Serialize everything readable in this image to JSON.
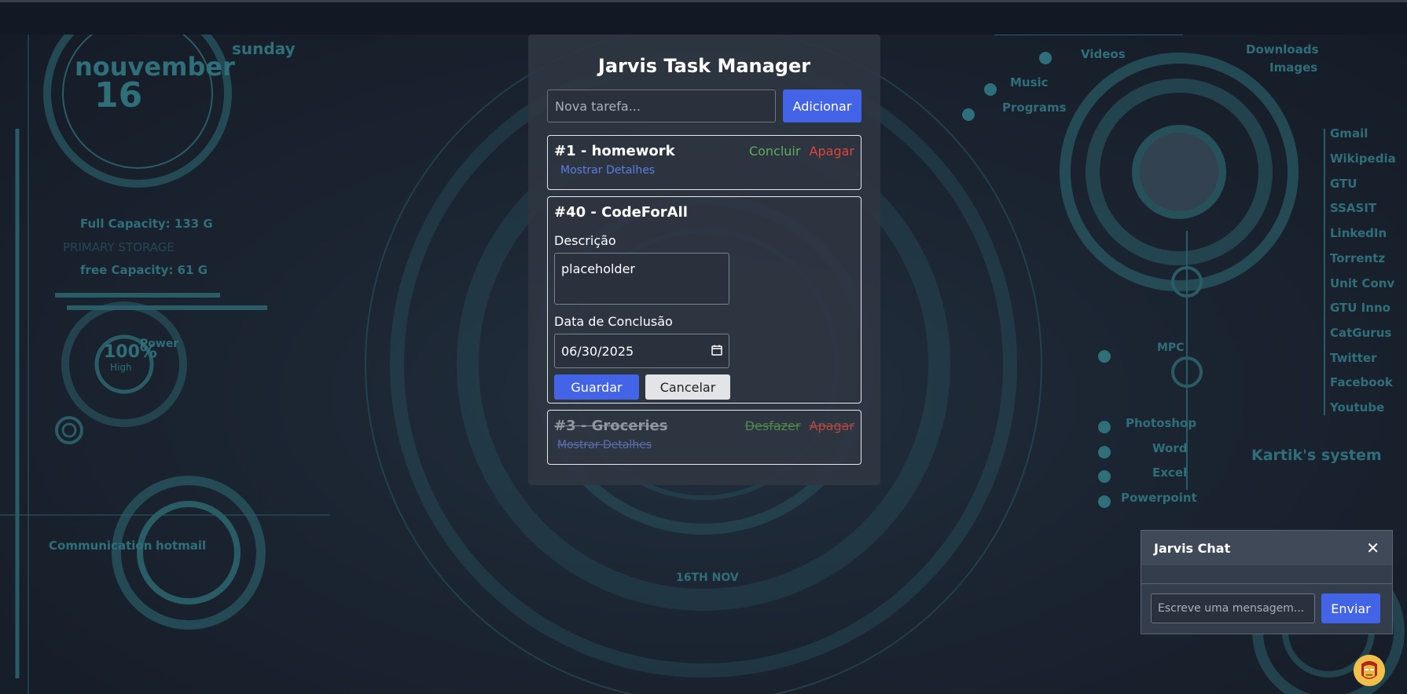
{
  "app": {
    "title": "Jarvis Task Manager"
  },
  "add_task": {
    "placeholder": "Nova tarefa...",
    "button_label": "Adicionar"
  },
  "tasks": [
    {
      "heading": "#1 - homework",
      "complete_label": "Concluir",
      "delete_label": "Apagar",
      "details_label": "Mostrar Detalhes",
      "completed": false
    },
    {
      "heading": "#40 - CodeForAll",
      "editing": true,
      "description_label": "Descrição",
      "description_value": "placeholder",
      "date_label": "Data de Conclusão",
      "date_value": "06/30/2025",
      "save_label": "Guardar",
      "cancel_label": "Cancelar"
    },
    {
      "heading": "#3 - Groceries",
      "undo_label": "Desfazer",
      "delete_label": "Apagar",
      "details_label": "Mostrar Detalhes",
      "completed": true
    }
  ],
  "chat": {
    "title": "Jarvis Chat",
    "close_symbol": "✕",
    "input_placeholder": "Escreve uma mensagem...",
    "send_label": "Enviar"
  },
  "background": {
    "month": "nouvember",
    "day_number": "16",
    "weekday": "sunday",
    "full_capacity": "Full Capacity:  133  G",
    "primary_storage": "PRIMARY STORAGE",
    "free_capacity": "free Capacity:  61  G",
    "power_pct": "100%",
    "power_label": "Power",
    "power_sub": "High",
    "communication": "Communication",
    "hotmail": "hotmail",
    "system_name": "Kartik's system",
    "hud_date": "16TH NOV",
    "links_top": [
      "Videos",
      "Downloads",
      "Images",
      "Music",
      "Programs"
    ],
    "links_right": [
      "Gmail",
      "Wikipedia",
      "GTU",
      "SSASIT",
      "LinkedIn",
      "Torrentz",
      "Unit Conv",
      "GTU Inno",
      "CatGurus",
      "Twitter",
      "Facebook",
      "Youtube"
    ],
    "mpc": "MPC",
    "links_bottom": [
      "Photoshop",
      "Word",
      "Excel",
      "Powerpoint"
    ]
  },
  "colors": {
    "accent": "#4464e8",
    "complete": "#5fad5a",
    "delete": "#e0443c",
    "hud": "#2f6f7a"
  }
}
